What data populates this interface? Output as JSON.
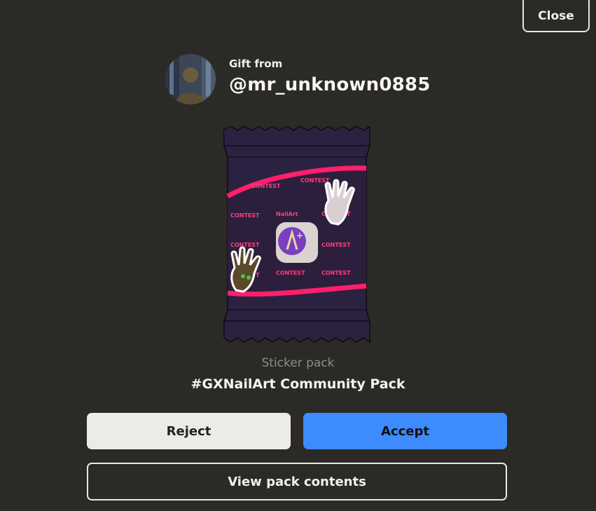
{
  "header": {
    "close_label": "Close"
  },
  "gift": {
    "from_label": "Gift from",
    "sender_username": "@mr_unknown0885"
  },
  "pack": {
    "type_label": "Sticker pack",
    "name": "#GXNailArt Community Pack"
  },
  "actions": {
    "reject_label": "Reject",
    "accept_label": "Accept",
    "view_contents_label": "View pack contents"
  },
  "colors": {
    "background": "#2b2a27",
    "accept_button": "#3d8bfd",
    "reject_button": "#ecebe6",
    "pack_wrapper": "#2a2240",
    "pack_accent": "#ff1f6b"
  }
}
